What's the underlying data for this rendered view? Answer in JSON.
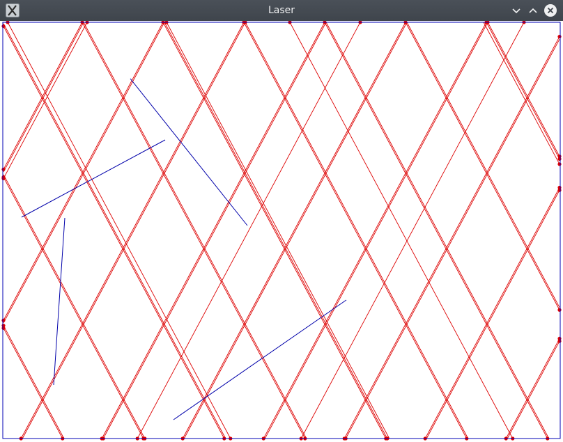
{
  "window": {
    "title": "Laser",
    "icons": {
      "app": "x-window-system-icon",
      "minimize": "chevron-down-icon",
      "maximize": "chevron-up-icon",
      "close": "close-icon"
    }
  },
  "colors": {
    "titlebar": "#454b52",
    "title_text": "#eff0f1",
    "boundary": "#0000b4",
    "laser": "#dd0000",
    "mirror": "#0000aa",
    "reflection_point": "#e00000"
  }
}
